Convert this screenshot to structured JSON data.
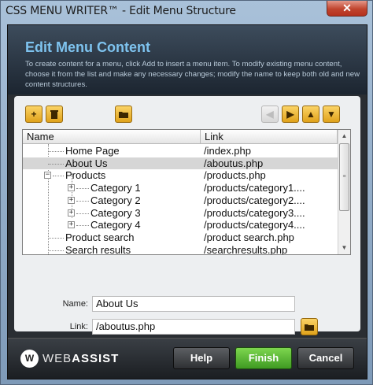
{
  "window": {
    "title": "CSS MENU WRITER™ - Edit Menu Structure",
    "close_label": "✕"
  },
  "header": {
    "title": "Edit Menu Content",
    "description": "To create content for a menu, click Add to insert a menu item. To modify existing menu content, choose it from the list and make any necessary changes; modify the name to keep both old and new content structures."
  },
  "toolbar": {
    "add_icon": "plus-icon",
    "delete_icon": "trash-icon",
    "browse_icon": "folder-icon",
    "outdent_icon": "arrow-left-icon",
    "indent_icon": "arrow-right-icon",
    "move_up_icon": "arrow-up-icon",
    "move_down_icon": "arrow-down-icon"
  },
  "tree": {
    "columns": [
      "Name",
      "Link"
    ],
    "rows": [
      {
        "name": "Home Page",
        "link": "/index.php"
      },
      {
        "name": "About Us",
        "link": "/aboutus.php"
      },
      {
        "name": "Products",
        "link": "/products.php"
      },
      {
        "name": "Category 1",
        "link": "/products/category1...."
      },
      {
        "name": "Category 2",
        "link": "/products/category2...."
      },
      {
        "name": "Category 3",
        "link": "/products/category3...."
      },
      {
        "name": "Category 4",
        "link": "/products/category4...."
      },
      {
        "name": "Product search",
        "link": "/product search.php"
      },
      {
        "name": "Search results",
        "link": "/searchresults.php"
      }
    ],
    "selected_row": "About Us"
  },
  "form": {
    "name_label": "Name:",
    "name_value": "About Us",
    "link_label": "Link:",
    "link_value": "/aboutus.php"
  },
  "footer": {
    "logo_mark": "W",
    "logo_text_light": "WEB",
    "logo_text_bold": "ASSIST",
    "help_label": "Help",
    "finish_label": "Finish",
    "cancel_label": "Cancel"
  },
  "colors": {
    "accent_title": "#7ec3ef",
    "toolbar_button": "#f3c13d",
    "finish_button": "#5bb833",
    "selected_row": "#d6d6d6"
  }
}
